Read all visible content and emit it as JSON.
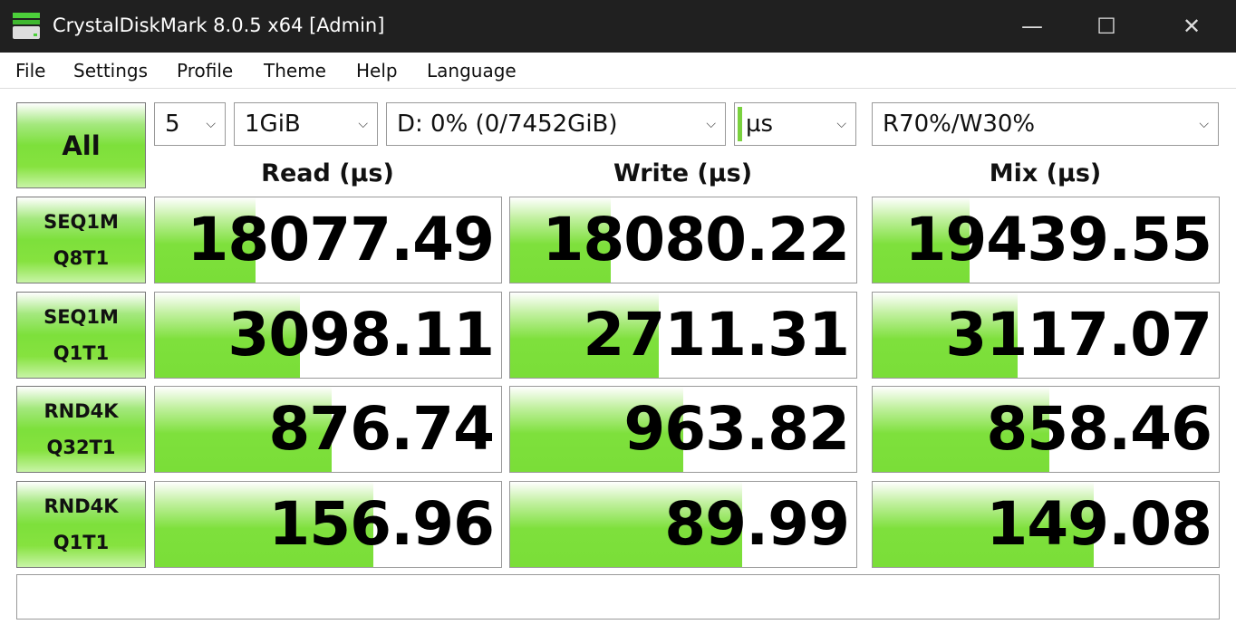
{
  "window": {
    "title": "CrystalDiskMark 8.0.5 x64 [Admin]",
    "minimize": "—",
    "maximize": "☐",
    "close": "✕"
  },
  "menu": [
    "File",
    "Settings",
    "Profile",
    "Theme",
    "Help",
    "Language"
  ],
  "controls": {
    "all_label": "All",
    "count": "5",
    "size": "1GiB",
    "drive": "D: 0% (0/7452GiB)",
    "unit": "µs",
    "mix": "R70%/W30%"
  },
  "columns": [
    "Read (µs)",
    "Write (µs)",
    "Mix (µs)"
  ],
  "accent": "#7de03b",
  "rows": [
    {
      "line1": "SEQ1M",
      "line2": "Q8T1",
      "values": [
        "18077.49",
        "18080.22",
        "19439.55"
      ],
      "fill": [
        0.29,
        0.29,
        0.28
      ]
    },
    {
      "line1": "SEQ1M",
      "line2": "Q1T1",
      "values": [
        "3098.11",
        "2711.31",
        "3117.07"
      ],
      "fill": [
        0.42,
        0.43,
        0.42
      ]
    },
    {
      "line1": "RND4K",
      "line2": "Q32T1",
      "values": [
        "876.74",
        "963.82",
        "858.46"
      ],
      "fill": [
        0.51,
        0.5,
        0.51
      ]
    },
    {
      "line1": "RND4K",
      "line2": "Q1T1",
      "values": [
        "156.96",
        "89.99",
        "149.08"
      ],
      "fill": [
        0.63,
        0.67,
        0.64
      ]
    }
  ],
  "status": ""
}
